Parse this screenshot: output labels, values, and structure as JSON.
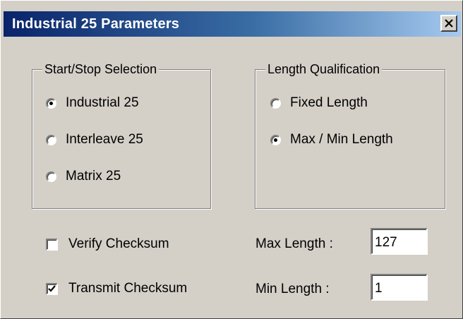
{
  "window": {
    "title": "Industrial 25 Parameters",
    "close_glyph": "×"
  },
  "start_stop": {
    "legend": "Start/Stop Selection",
    "options": [
      {
        "label": "Industrial 25",
        "selected": true
      },
      {
        "label": "Interleave 25",
        "selected": false
      },
      {
        "label": "Matrix 25",
        "selected": false
      }
    ]
  },
  "length_qualification": {
    "legend": "Length Qualification",
    "options": [
      {
        "label": "Fixed Length",
        "selected": false
      },
      {
        "label": "Max / Min Length",
        "selected": true
      }
    ]
  },
  "checksum": {
    "verify": {
      "label": "Verify Checksum",
      "checked": false
    },
    "transmit": {
      "label": "Transmit Checksum",
      "checked": true
    }
  },
  "lengths": {
    "max": {
      "label": "Max Length :",
      "value": "127"
    },
    "min": {
      "label": "Min Length :",
      "value": "1"
    }
  }
}
